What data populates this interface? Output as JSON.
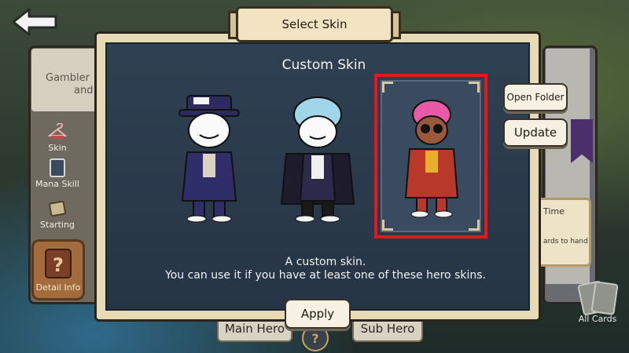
{
  "dialog": {
    "title": "Select Skin",
    "section_title": "Custom Skin",
    "description_line1": "A custom skin.",
    "description_line2": "You can use it if you have at least one of these hero skins.",
    "buttons": {
      "open_folder": "Open Folder",
      "update": "Update",
      "apply": "Apply"
    },
    "skins": [
      {
        "icon": "gambler-hero-purple-hat-icon",
        "selected": false
      },
      {
        "icon": "gambler-hero-blue-hair-icon",
        "selected": false
      },
      {
        "icon": "gambler-hero-pink-hair-red-suit-icon",
        "selected": true
      }
    ]
  },
  "background": {
    "left_panel": {
      "title": "Gambler",
      "title_line2": "and",
      "menu": [
        {
          "label": "Skin",
          "icon": "hanger-icon"
        },
        {
          "label": "Mana Skill",
          "icon": "card-icon"
        },
        {
          "label": "Starting",
          "icon": "scroll-icon"
        }
      ],
      "detail_tab": "Detail Info"
    },
    "right_panel": {
      "card_text_top": "Time",
      "card_text_bottom": "ards to hand",
      "all_cards": "All Cards"
    },
    "bottom": {
      "main_hero": "Main Hero",
      "sub_hero": "Sub Hero",
      "center_symbol": "?"
    }
  },
  "colors": {
    "selection_border": "#e6171b",
    "dialog_bg": "#2f4052",
    "parchment": "#e7dbb6"
  }
}
